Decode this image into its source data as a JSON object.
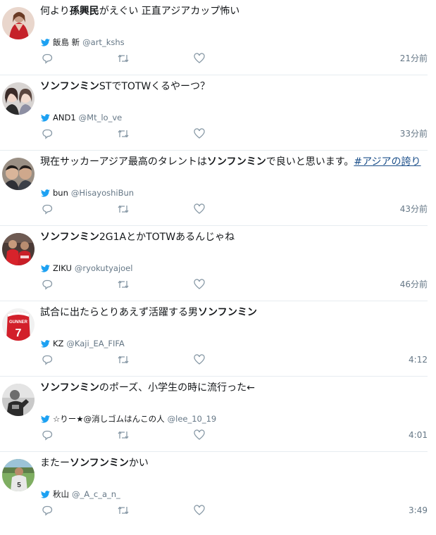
{
  "accent_color": "#1da1f2",
  "tweets": [
    {
      "segments": [
        {
          "text": "何より",
          "style": "plain"
        },
        {
          "text": "孫興民",
          "style": "bold"
        },
        {
          "text": "がえぐい 正直アジアカップ怖い",
          "style": "plain"
        }
      ],
      "author_name": "飯島 新",
      "handle": "@art_kshs",
      "time": "21分前",
      "avatar": "avatar-woman-red-dress"
    },
    {
      "segments": [
        {
          "text": "ソンフンミン",
          "style": "bold"
        },
        {
          "text": "STでTOTWくるやーつ？",
          "style": "plain"
        }
      ],
      "author_name": "AND1",
      "handle": "@Mt_lo_ve",
      "time": "33分前",
      "avatar": "avatar-two-girls"
    },
    {
      "segments": [
        {
          "text": "現在サッカーアジア最高のタレントは",
          "style": "plain"
        },
        {
          "text": "ソンフンミン",
          "style": "bold"
        },
        {
          "text": "で良いと思います。",
          "style": "plain"
        },
        {
          "text": "#アジアの誇り",
          "style": "hashtag"
        }
      ],
      "author_name": "bun",
      "handle": "@HisayoshiBun",
      "time": "43分前",
      "avatar": "avatar-two-men"
    },
    {
      "segments": [
        {
          "text": "ソンフンミン",
          "style": "bold"
        },
        {
          "text": "2G1AとかTOTWあるんじゃね",
          "style": "plain"
        }
      ],
      "author_name": "ZIKU",
      "handle": "@ryokutyajoel",
      "time": "46分前",
      "avatar": "avatar-soccer-players"
    },
    {
      "segments": [
        {
          "text": "試合に出たらとりあえず活躍する男",
          "style": "plain"
        },
        {
          "text": "ソンフンミン",
          "style": "bold"
        }
      ],
      "author_name": "KZ",
      "handle": "@Kaji_EA_FIFA",
      "time": "4:12",
      "avatar": "avatar-gunner-jersey"
    },
    {
      "segments": [
        {
          "text": "ソンフンミン",
          "style": "bold"
        },
        {
          "text": "のポーズ、小学生の時に流行った←",
          "style": "plain"
        }
      ],
      "author_name": "☆りー★@消しゴムはんこの人",
      "handle": "@lee_10_19",
      "time": "4:01",
      "avatar": "avatar-player-bw"
    },
    {
      "segments": [
        {
          "text": "またー",
          "style": "plain"
        },
        {
          "text": "ソンフンミン",
          "style": "bold"
        },
        {
          "text": "かい",
          "style": "plain"
        }
      ],
      "author_name": "秋山",
      "handle": "@_A_c_a_n_",
      "time": "3:49",
      "avatar": "avatar-player-number-5"
    }
  ],
  "icons": {
    "bird": "twitter-bird-icon",
    "reply": "reply-icon",
    "retweet": "retweet-icon",
    "like": "like-heart-icon"
  }
}
